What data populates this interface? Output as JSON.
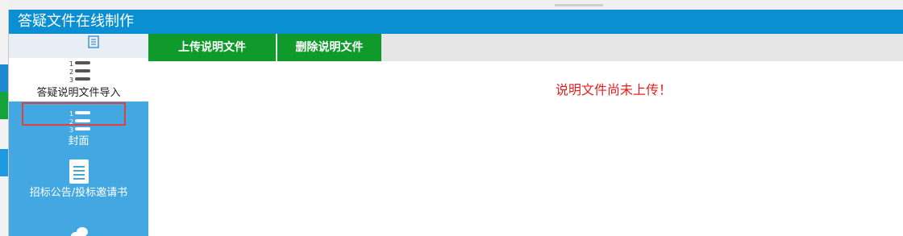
{
  "window": {
    "title": "答疑文件在线制作"
  },
  "toolbar": {
    "upload_label": "上传说明文件",
    "delete_label": "删除说明文件"
  },
  "sidebar": {
    "items": [
      {
        "label": "答疑说明文件导入",
        "icon": "numbered-list-icon",
        "active": true
      },
      {
        "label": "封面",
        "icon": "numbered-list-icon",
        "active": false
      },
      {
        "label": "招标公告/投标邀请书",
        "icon": "document-icon",
        "active": false
      },
      {
        "label": "",
        "icon": "chat-icon",
        "active": false
      }
    ]
  },
  "main": {
    "status_message": "说明文件尚未上传！"
  },
  "colors": {
    "titlebar": "#0a8fd2",
    "sidebar": "#43a7e1",
    "button": "#0f9a2b",
    "status_text": "#e02020",
    "highlight": "#e0413f"
  }
}
